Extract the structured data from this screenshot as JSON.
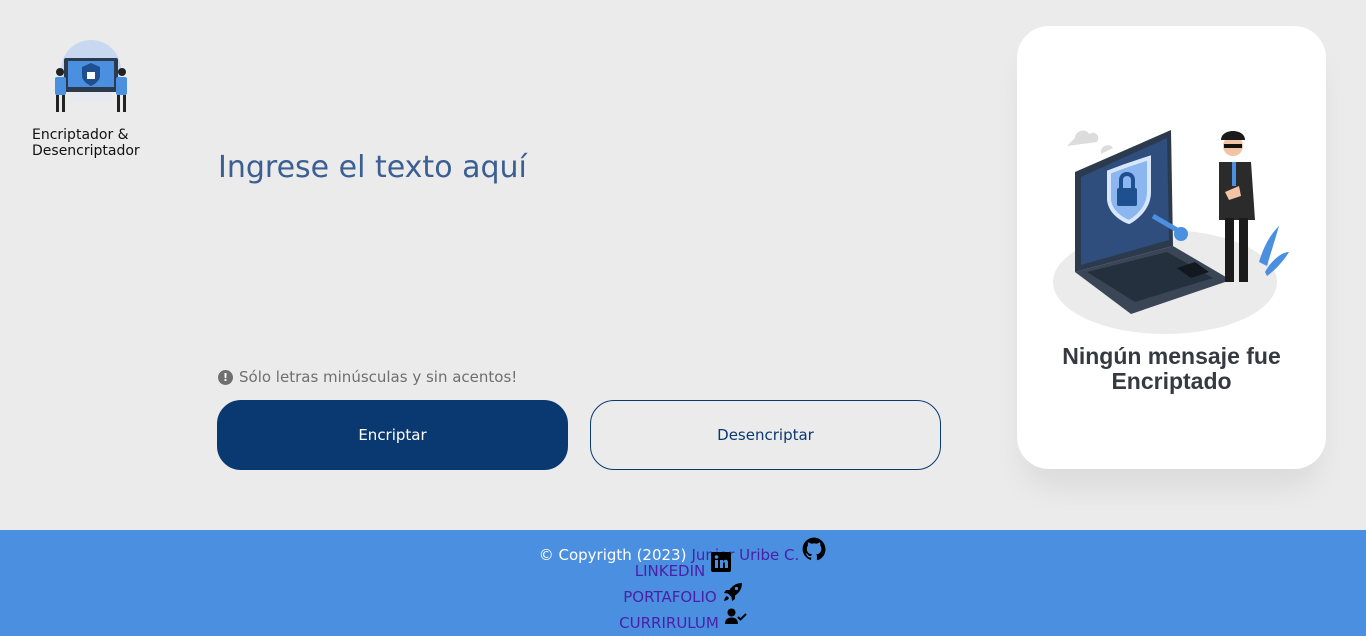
{
  "brand": {
    "name_line1": "Encriptador &",
    "name_line2": "Desencriptador",
    "logo_icon": "security-guards-laptop-logo"
  },
  "main": {
    "input_placeholder": "Ingrese el texto aquí",
    "hint_icon": "exclamation-circle-icon",
    "hint_text": "Sólo letras minúsculas y sin acentos!",
    "encrypt_label": "Encriptar",
    "decrypt_label": "Desencriptar"
  },
  "result": {
    "illustration": "security-guard-laptop-illustration",
    "title_line1": "Ningún mensaje fue",
    "title_line2": "Encriptado"
  },
  "footer": {
    "copyright": "© Copyrigth (2023)",
    "author": "Junior Uribe C.",
    "links": [
      "LINKEDIN",
      "PORTAFOLIO",
      "CURRIRULUM"
    ],
    "icons": [
      "github-icon",
      "linkedin-icon",
      "rocket-icon",
      "user-check-icon"
    ]
  },
  "colors": {
    "primary": "#0a3871",
    "background": "#ebebeb",
    "footer": "#4a8fe0",
    "link": "#4b1fa8",
    "placeholder": "#3b5f93"
  }
}
